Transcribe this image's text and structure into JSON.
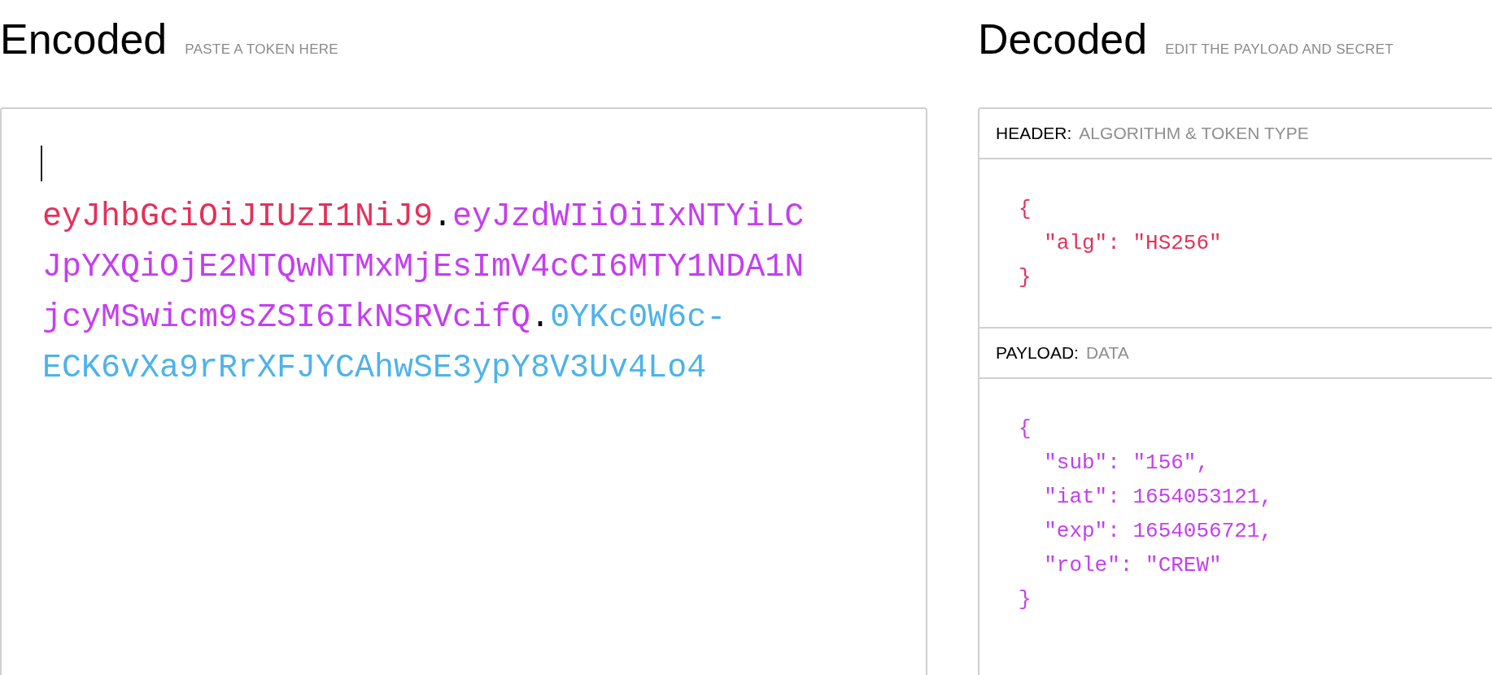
{
  "encoded": {
    "title": "Encoded",
    "subtitle": "PASTE A TOKEN HERE",
    "token": [
      {
        "text": "eyJhbGciOiJIUzI1NiJ9",
        "color": "#e5305a"
      },
      {
        "text": ".",
        "color": "#000000"
      },
      {
        "text": "eyJzdWIiOiIxNTYiLCJpYXQiOjE2NTQwNTMxMjEsImV4cCI6MTY1NDA1NjcyMSwicm9sZSI6IkNSRVcifQ",
        "color": "#c53ef0"
      },
      {
        "text": ".",
        "color": "#000000"
      },
      {
        "text": "0YKc0W6c-ECK6vXa9rRrXFJYCAhwSE3ypY8V3Uv4Lo4",
        "color": "#4db3ea"
      }
    ]
  },
  "decoded": {
    "title": "Decoded",
    "subtitle": "EDIT THE PAYLOAD AND SECRET",
    "sections": [
      {
        "label": "HEADER:",
        "hint": "ALGORITHM & TOKEN TYPE",
        "color": "#e5305a",
        "lines": [
          "{",
          "  \"alg\": \"HS256\"",
          "}"
        ]
      },
      {
        "label": "PAYLOAD:",
        "hint": "DATA",
        "color": "#c53ef0",
        "lines": [
          "{",
          "  \"sub\": \"156\",",
          "  \"iat\": 1654053121,",
          "  \"exp\": 1654056721,",
          "  \"role\": \"CREW\"",
          "}"
        ]
      }
    ]
  }
}
